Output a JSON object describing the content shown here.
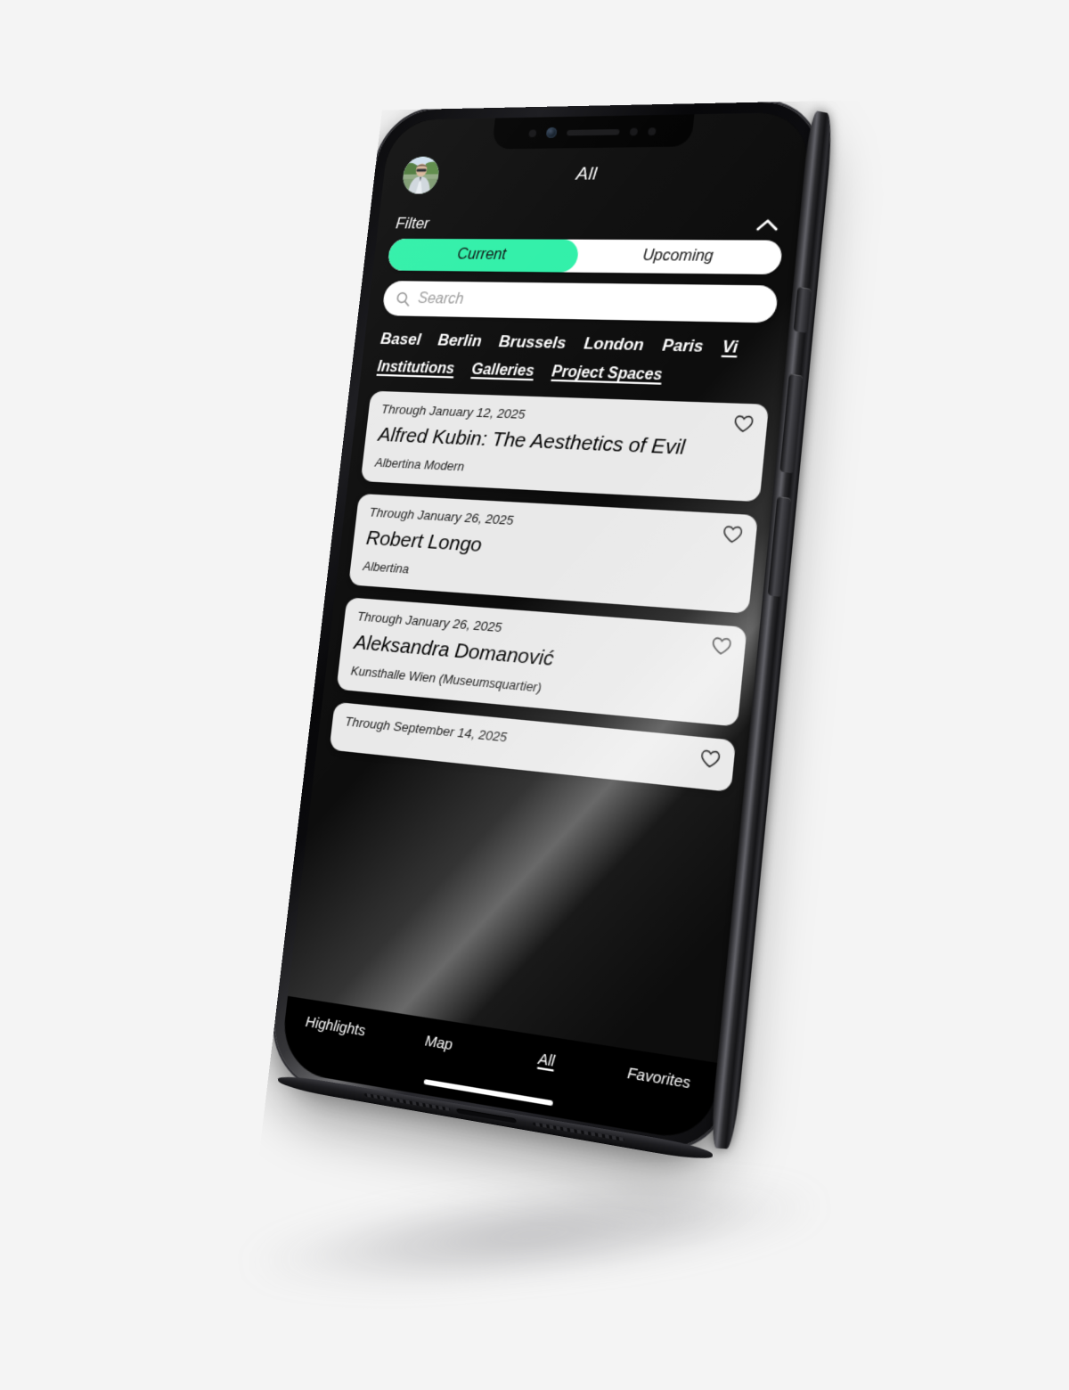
{
  "theme": {
    "page_background": "#f4f4f4",
    "screen_background": "#0d0d0d",
    "accent_green": "#2ff0a8",
    "card_background": "#e9e9e9",
    "text_on_dark": "#ffffff",
    "text_on_card": "#000000"
  },
  "header": {
    "title": "All",
    "avatar_icon": "user-photo-avatar"
  },
  "filter": {
    "label": "Filter",
    "collapse_icon": "chevron-up-icon",
    "segmented": {
      "options": [
        "Current",
        "Upcoming"
      ],
      "selected": "Current"
    },
    "search": {
      "value": "",
      "placeholder": "Search",
      "icon": "search-icon"
    },
    "cities": [
      {
        "label": "Basel",
        "selected": false
      },
      {
        "label": "Berlin",
        "selected": false
      },
      {
        "label": "Brussels",
        "selected": false
      },
      {
        "label": "London",
        "selected": false
      },
      {
        "label": "Paris",
        "selected": false
      },
      {
        "label": "Vi",
        "selected": true
      }
    ],
    "types": [
      {
        "label": "Institutions",
        "selected": true
      },
      {
        "label": "Galleries",
        "selected": true
      },
      {
        "label": "Project Spaces",
        "selected": true
      }
    ]
  },
  "list": {
    "favorite_icon": "heart-outline-icon",
    "cards": [
      {
        "date": "Through January 12, 2025",
        "title": "Alfred Kubin: The Aesthetics of Evil",
        "venue": "Albertina Modern",
        "favorited": false
      },
      {
        "date": "Through January 26, 2025",
        "title": "Robert Longo",
        "venue": "Albertina",
        "favorited": false
      },
      {
        "date": "Through January 26, 2025",
        "title": "Aleksandra Domanović",
        "venue": "Kunsthalle Wien (Museumsquartier)",
        "favorited": false
      },
      {
        "date": "Through September 14, 2025",
        "title": "",
        "venue": "",
        "favorited": false
      }
    ]
  },
  "tabbar": {
    "tabs": [
      {
        "label": "Highlights",
        "active": false
      },
      {
        "label": "Map",
        "active": false
      },
      {
        "label": "All",
        "active": true
      },
      {
        "label": "Favorites",
        "active": false
      }
    ]
  }
}
